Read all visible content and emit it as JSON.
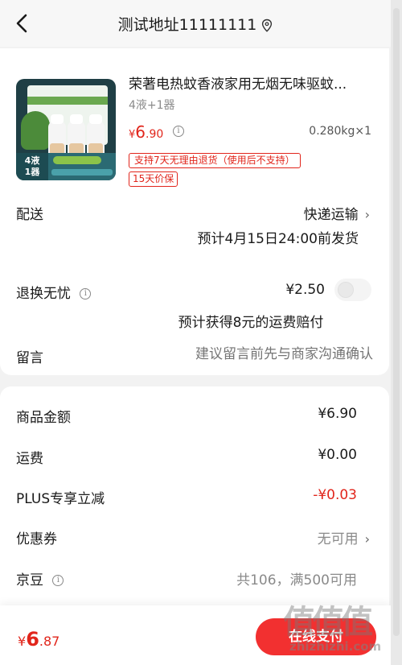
{
  "header": {
    "title": "测试地址11111111"
  },
  "product": {
    "name": "荣著电热蚊香液家用无烟无味驱蚊...",
    "spec": "4液+1器",
    "price_symbol": "¥",
    "price_int": "6",
    "price_dec": ".90",
    "weight_qty": "0.280kg×1",
    "tag_return": "支持7天无理由退货（使用后不支持）",
    "tag_protect": "15天价保",
    "image_badge": "4液\n1器"
  },
  "delivery": {
    "label": "配送",
    "method": "快递运输",
    "eta": "预计4月15日24:00前发货"
  },
  "return_worry": {
    "label": "退换无忧",
    "price": "¥2.50",
    "compensation": "预计获得8元的运费赔付",
    "enabled": false
  },
  "message": {
    "label": "留言",
    "placeholder": "建议留言前先与商家沟通确认"
  },
  "summary": {
    "goods_label": "商品金额",
    "goods_value": "¥6.90",
    "shipping_label": "运费",
    "shipping_value": "¥0.00",
    "plus_label": "PLUS专享立减",
    "plus_value": "-¥0.03",
    "coupon_label": "优惠券",
    "coupon_value": "无可用",
    "jingdou_label": "京豆",
    "jingdou_value": "共106，满500可用"
  },
  "bottom": {
    "total_symbol": "¥",
    "total_int": "6",
    "total_dec": ".87",
    "pay_label": "在线支付"
  },
  "watermark": {
    "glyphs": "值值值",
    "text": "zhizhizhi.com"
  },
  "colors": {
    "accent": "#e1251b",
    "button": "#f23030",
    "background": "#f2f2f2"
  }
}
